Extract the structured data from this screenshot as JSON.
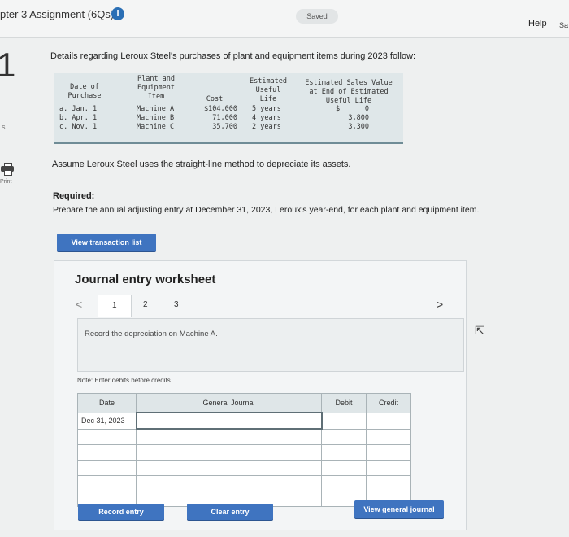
{
  "header": {
    "assignment_title": "pter 3 Assignment (6Qs)",
    "info_glyph": "i",
    "saved_label": "Saved",
    "help_label": "Help",
    "extra_label": "Sa"
  },
  "gutter": {
    "question_number": "1",
    "side_mark": "s",
    "print_label": "Print"
  },
  "problem": {
    "details_text": "Details regarding Leroux Steel's purchases of plant and equipment items during 2023 follow:",
    "table": {
      "h_date": [
        "Date of",
        "Purchase"
      ],
      "h_item": [
        "Plant and",
        "Equipment",
        "Item"
      ],
      "h_cost": "Cost",
      "h_life": [
        "Estimated",
        "Useful",
        "Life"
      ],
      "h_salvage": [
        "Estimated Sales Value",
        "at End of Estimated",
        "Useful Life"
      ],
      "rows": [
        {
          "date": "a. Jan. 1",
          "item": "Machine A",
          "cost": "$104,000",
          "life": "5 years",
          "salvage": "$      0"
        },
        {
          "date": "b. Apr. 1",
          "item": "Machine B",
          "cost": "71,000",
          "life": "4 years",
          "salvage": "3,800"
        },
        {
          "date": "c. Nov. 1",
          "item": "Machine C",
          "cost": "35,700",
          "life": "2 years",
          "salvage": "3,300"
        }
      ]
    },
    "assume_text": "Assume Leroux Steel uses the straight-line method to depreciate its assets.",
    "required_label": "Required:",
    "prepare_text": "Prepare the annual adjusting entry at December 31, 2023, Leroux's year-end, for each plant and equipment item.",
    "view_transaction_label": "View transaction list"
  },
  "worksheet": {
    "title": "Journal entry worksheet",
    "prev_glyph": "<",
    "next_glyph": ">",
    "pages": [
      "1",
      "2",
      "3"
    ],
    "instruction": "Record the depreciation on Machine A.",
    "cursor_glyph": "⇱",
    "note": "Note: Enter debits before credits.",
    "columns": {
      "date": "Date",
      "account": "General Journal",
      "debit": "Debit",
      "credit": "Credit"
    },
    "rows": [
      {
        "date": "Dec 31, 2023",
        "account": "",
        "debit": "",
        "credit": ""
      },
      {
        "date": "",
        "account": "",
        "debit": "",
        "credit": ""
      },
      {
        "date": "",
        "account": "",
        "debit": "",
        "credit": ""
      },
      {
        "date": "",
        "account": "",
        "debit": "",
        "credit": ""
      },
      {
        "date": "",
        "account": "",
        "debit": "",
        "credit": ""
      },
      {
        "date": "",
        "account": "",
        "debit": "",
        "credit": ""
      }
    ],
    "buttons": {
      "record": "Record entry",
      "clear": "Clear entry",
      "view_general": "View general journal"
    }
  }
}
